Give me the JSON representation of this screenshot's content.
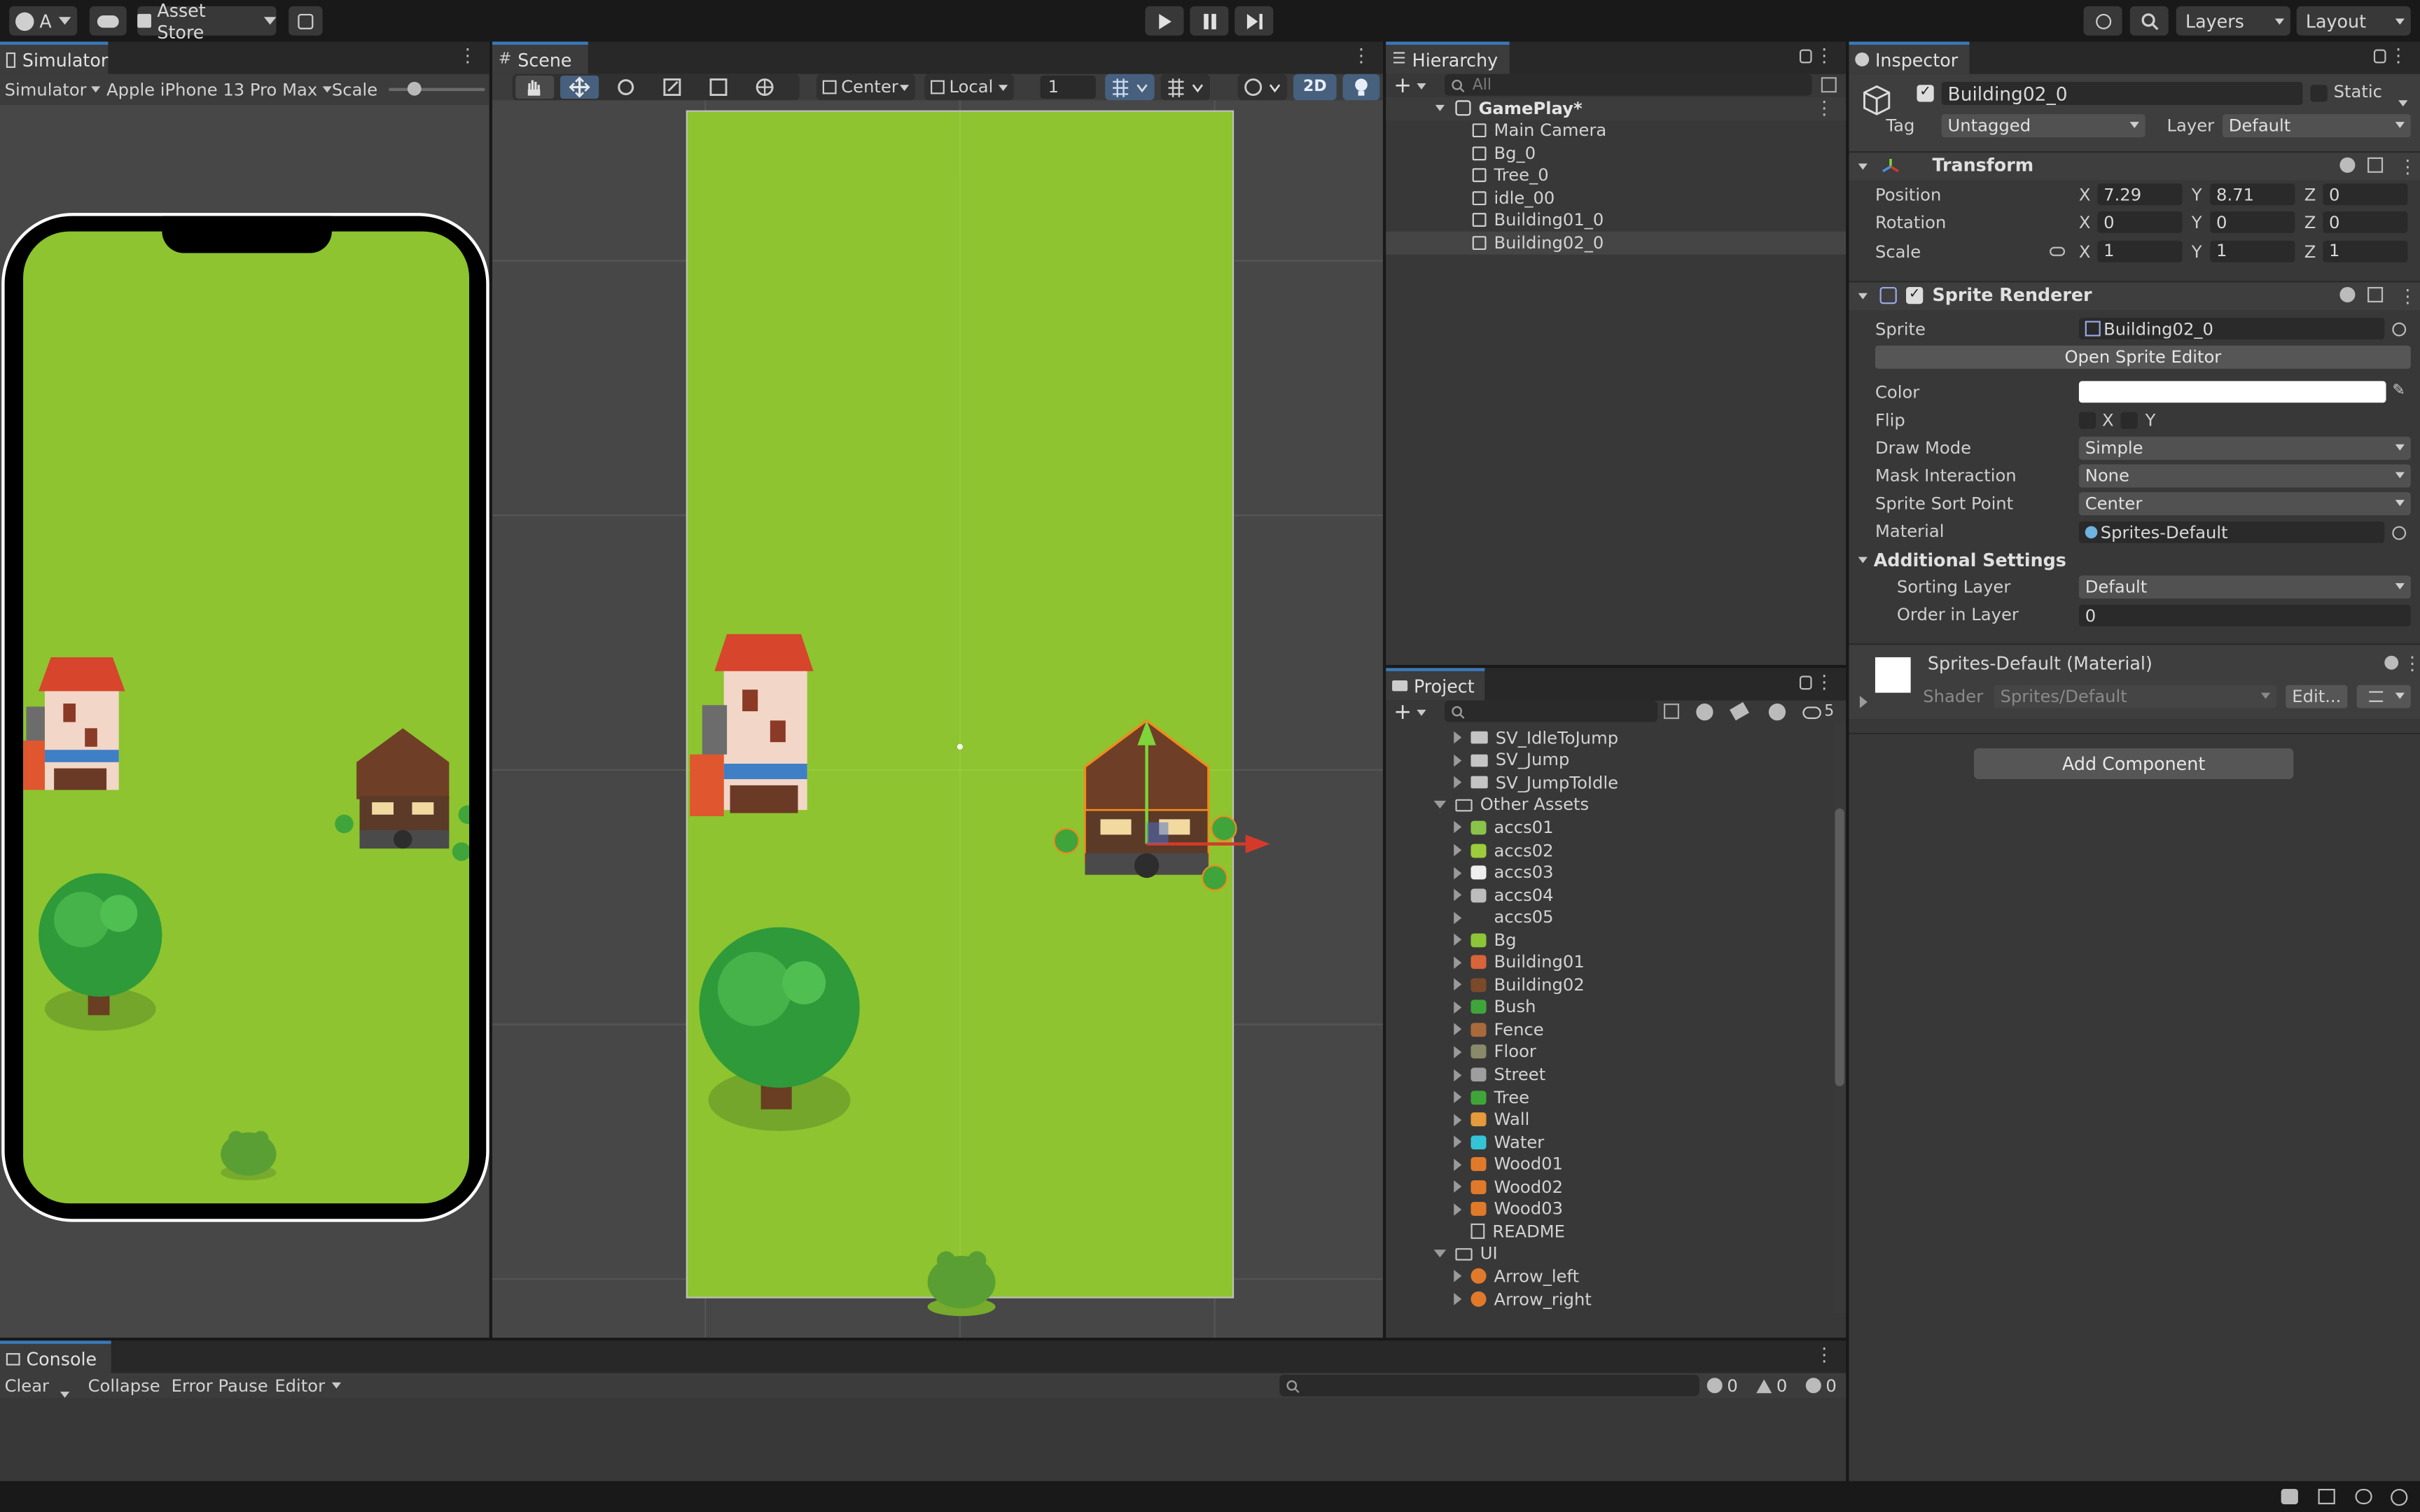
{
  "toolbar": {
    "account": "A",
    "asset_store": "Asset Store",
    "layers": "Layers",
    "layout": "Layout"
  },
  "simulator": {
    "tab": "Simulator",
    "mode": "Simulator",
    "device": "Apple iPhone 13 Pro Max",
    "scale_label": "Scale"
  },
  "scene": {
    "tab": "Scene",
    "pivot": "Center",
    "space": "Local",
    "grid_snap_value": "1",
    "mode_2d": "2D"
  },
  "hierarchy": {
    "tab": "Hierarchy",
    "search_placeholder": "All",
    "root": "GamePlay*",
    "items": [
      "Main Camera",
      "Bg_0",
      "Tree_0",
      "idle_00",
      "Building01_0",
      "Building02_0"
    ],
    "selected": "Building02_0"
  },
  "project": {
    "tab": "Project",
    "hidden_count": "5",
    "folders_top": [
      "SV_IdleToJump",
      "SV_Jump",
      "SV_JumpToIdle"
    ],
    "other_assets_label": "Other Assets",
    "assets": [
      {
        "name": "accs01",
        "color": "#8bc34a"
      },
      {
        "name": "accs02",
        "color": "#9ccc3b"
      },
      {
        "name": "accs03",
        "color": "#eeeeee"
      },
      {
        "name": "accs04",
        "color": "#bdbdbd"
      },
      {
        "name": "accs05",
        "color": "#383838"
      },
      {
        "name": "Bg",
        "color": "#8ec536"
      },
      {
        "name": "Building01",
        "color": "#d9643a"
      },
      {
        "name": "Building02",
        "color": "#7a4a2b"
      },
      {
        "name": "Bush",
        "color": "#3fa53a"
      },
      {
        "name": "Fence",
        "color": "#a86a3a"
      },
      {
        "name": "Floor",
        "color": "#8a8a6a"
      },
      {
        "name": "Street",
        "color": "#9e9e9e"
      },
      {
        "name": "Tree",
        "color": "#3fa53a"
      },
      {
        "name": "Wall",
        "color": "#e59a3b"
      },
      {
        "name": "Water",
        "color": "#34c4d6"
      },
      {
        "name": "Wood01",
        "color": "#e07a2a"
      },
      {
        "name": "Wood02",
        "color": "#e07a2a"
      },
      {
        "name": "Wood03",
        "color": "#e07a2a"
      }
    ],
    "readme": "README",
    "ui_folder": "UI",
    "ui_items": [
      "Arrow_left",
      "Arrow_right"
    ]
  },
  "inspector": {
    "tab": "Inspector",
    "object_name": "Building02_0",
    "static_label": "Static",
    "tag_label": "Tag",
    "tag_value": "Untagged",
    "layer_label": "Layer",
    "layer_value": "Default",
    "transform": {
      "title": "Transform",
      "position_label": "Position",
      "rotation_label": "Rotation",
      "scale_label": "Scale",
      "position": {
        "x": "7.29",
        "y": "8.71",
        "z": "0"
      },
      "rotation": {
        "x": "0",
        "y": "0",
        "z": "0"
      },
      "scale": {
        "x": "1",
        "y": "1",
        "z": "1"
      }
    },
    "sprite_renderer": {
      "title": "Sprite Renderer",
      "sprite_label": "Sprite",
      "sprite_value": "Building02_0",
      "open_editor": "Open Sprite Editor",
      "color_label": "Color",
      "flip_label": "Flip",
      "flip_x": "X",
      "flip_y": "Y",
      "draw_mode_label": "Draw Mode",
      "draw_mode": "Simple",
      "mask_label": "Mask Interaction",
      "mask": "None",
      "sort_point_label": "Sprite Sort Point",
      "sort_point": "Center",
      "material_label": "Material",
      "material": "Sprites-Default",
      "additional": "Additional Settings",
      "sorting_layer_label": "Sorting Layer",
      "sorting_layer": "Default",
      "order_label": "Order in Layer",
      "order": "0"
    },
    "material": {
      "title": "Sprites-Default (Material)",
      "shader_label": "Shader",
      "shader": "Sprites/Default",
      "edit": "Edit..."
    },
    "add_component": "Add Component"
  },
  "console": {
    "tab": "Console",
    "clear": "Clear",
    "collapse": "Collapse",
    "error_pause": "Error Pause",
    "editor": "Editor",
    "log_count": "0",
    "warn_count": "0",
    "error_count": "0"
  },
  "colors": {
    "grass": "#8dc42f",
    "selection_orange": "#f28a1e",
    "accent_blue": "#3a79bb"
  }
}
